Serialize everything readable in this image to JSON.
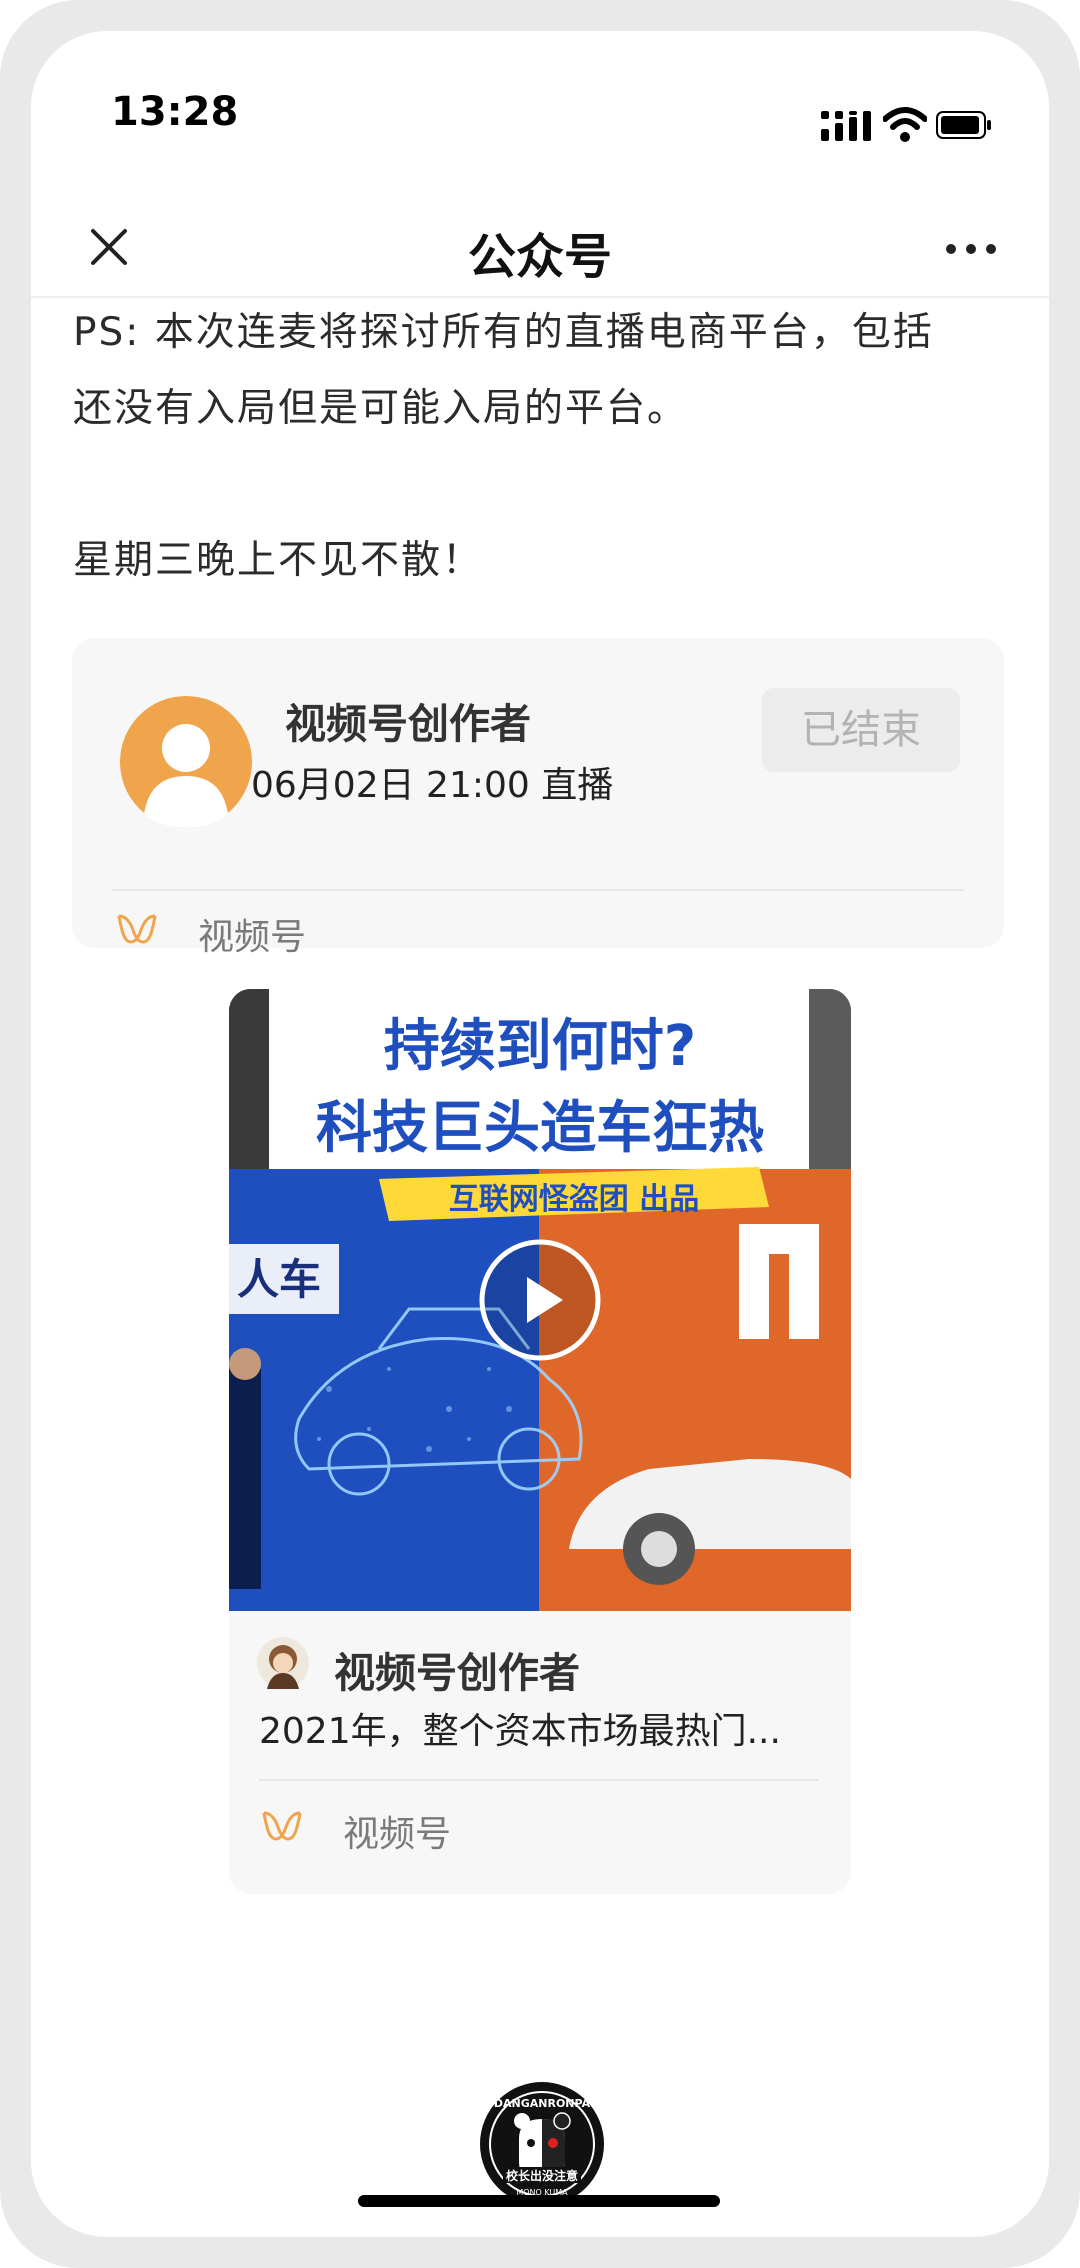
{
  "status_bar": {
    "time": "13:28"
  },
  "header": {
    "title": "公众号"
  },
  "article": {
    "line1": "PS: 本次连麦将探讨所有的直播电商平台，包括",
    "line2": "还没有入局但是可能入局的平台。",
    "line3": "星期三晚上不见不散！"
  },
  "live_card": {
    "creator_name": "视频号创作者",
    "schedule": "06月02日 21:00 直播",
    "status_button": "已结束",
    "channel_label": "视频号"
  },
  "video_card": {
    "thumbnail_title_line1": "持续到何时?",
    "thumbnail_title_line2": "科技巨头造车狂热",
    "thumbnail_badge": "互联网怪盗团 出品",
    "thumbnail_left_text": "人车",
    "creator_name": "视频号创作者",
    "description": "2021年，整个资本市场最热门...",
    "channel_label": "视频号"
  },
  "footer_logo": {
    "text_top": "DANGANRONPA",
    "text_middle": "校长出没注意",
    "text_bottom": "MONO KUMA"
  },
  "colors": {
    "accent_orange": "#f0a44b",
    "card_bg": "#f7f7f7",
    "thumb_blue": "#1f4fbf",
    "thumb_orange": "#e0672a"
  }
}
